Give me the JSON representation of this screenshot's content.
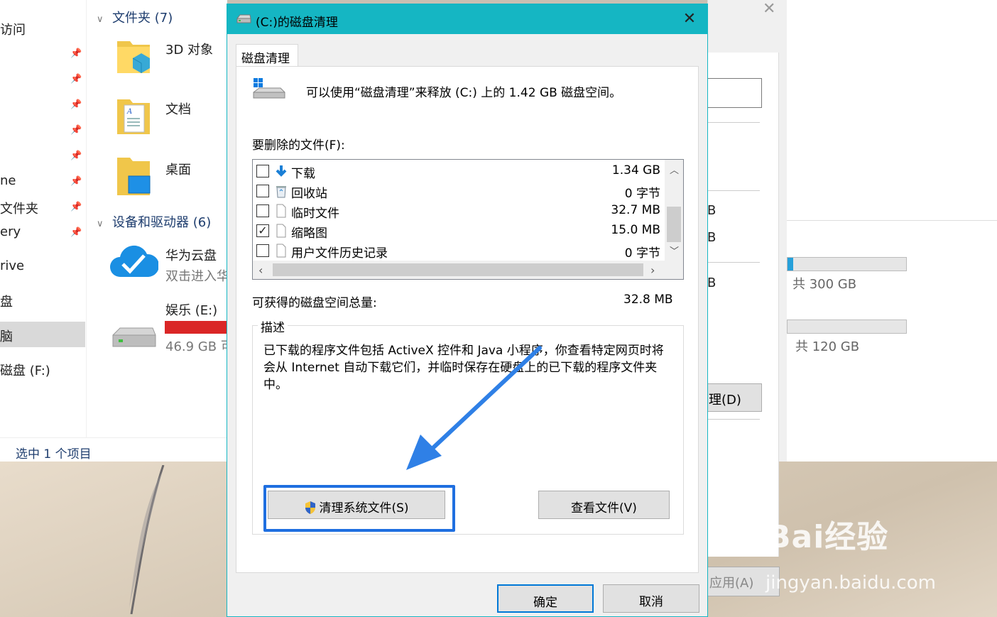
{
  "explorer": {
    "nav": [
      {
        "label": "访问",
        "pinned": false
      },
      {
        "label": "ne",
        "pinned": false
      },
      {
        "label": "文件夹",
        "pinned": false
      },
      {
        "label": "ery",
        "pinned": false
      },
      {
        "label": "rive",
        "pinned": false
      },
      {
        "label": "盘",
        "pinned": false
      },
      {
        "label": "脑",
        "pinned": false
      },
      {
        "label": "磁盘 (F:)",
        "pinned": false
      }
    ],
    "folders_section": "文件夹 (7)",
    "folders": [
      "3D 对象",
      "文档",
      "桌面"
    ],
    "devices_section": "设备和驱动器 (6)",
    "devices": [
      {
        "name": "华为云盘",
        "sub": "双击进入华"
      },
      {
        "name": "娱乐 (E:)",
        "sub": "46.9 GB 可"
      }
    ],
    "status": "选中 1 个项目"
  },
  "properties": {
    "items": [
      "B",
      "B",
      "B"
    ],
    "capacity1": "共 300 GB",
    "capacity1_fill": 0.05,
    "capacity2": "共 120 GB",
    "capacity2_fill": 0.0,
    "cleanup_button": "理(D)",
    "apply_button": "应用(A)"
  },
  "dialog": {
    "title": "(C:)的磁盘清理",
    "tab": "磁盘清理",
    "intro": "可以使用“磁盘清理”来释放  (C:) 上的 1.42 GB 磁盘空间。",
    "files_label": "要删除的文件(F):",
    "files": [
      {
        "name": "下载",
        "size": "1.34 GB",
        "checked": false,
        "icon": "download-icon"
      },
      {
        "name": "回收站",
        "size": "0 字节",
        "checked": false,
        "icon": "recycle-bin-icon"
      },
      {
        "name": "临时文件",
        "size": "32.7 MB",
        "checked": false,
        "icon": "file-icon"
      },
      {
        "name": "缩略图",
        "size": "15.0 MB",
        "checked": true,
        "icon": "file-icon"
      },
      {
        "name": "用户文件历史记录",
        "size": "0 字节",
        "checked": false,
        "icon": "file-icon"
      }
    ],
    "total_label": "可获得的磁盘空间总量:",
    "total_value": "32.8 MB",
    "description_title": "描述",
    "description": "已下载的程序文件包括 ActiveX 控件和 Java 小程序，你查看特定网页时将会从 Internet 自动下载它们，并临时保存在硬盘上的已下载的程序文件夹中。",
    "clean_system_button": "清理系统文件(S)",
    "view_files_button": "查看文件(V)",
    "ok_button": "确定",
    "cancel_button": "取消"
  },
  "watermark": {
    "brand": "Bai经验",
    "url": "jingyan.baidu.com"
  },
  "colors": {
    "titlebar": "#15b6c3",
    "highlight": "#1f6fe0",
    "red_bar": "#da2626"
  }
}
